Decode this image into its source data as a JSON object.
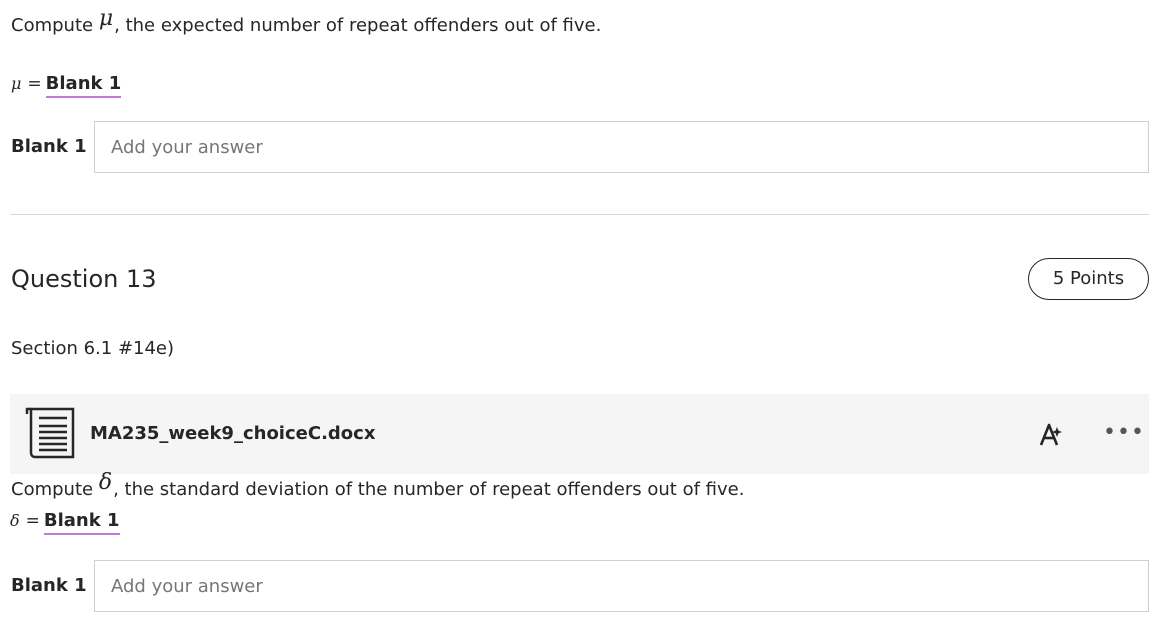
{
  "q12_tail": {
    "prompt_prefix": "Compute ",
    "prompt_symbol": "μ",
    "prompt_suffix": ", the expected number of repeat offenders out of five.",
    "formula_symbol": "μ",
    "formula_equals": "=",
    "formula_blank": "Blank 1",
    "blank_label": "Blank 1",
    "answer_placeholder": "Add your answer",
    "answer_value": ""
  },
  "question13": {
    "title": "Question 13",
    "points": "5 Points",
    "section_ref": "Section 6.1 #14e)",
    "attachment": {
      "file_name": "MA235_week9_choiceC.docx",
      "file_icon": "document-icon",
      "reader_icon": "immersive-reader-icon",
      "more_icon": "more-options-icon",
      "more_glyph": "•••"
    },
    "prompt_prefix": "Compute ",
    "prompt_symbol": "δ",
    "prompt_suffix": ", the standard deviation of the number of repeat offenders out of five.",
    "formula_symbol": "δ",
    "formula_equals": "=",
    "formula_blank": "Blank 1",
    "blank_label": "Blank 1",
    "answer_placeholder": "Add your answer",
    "answer_value": ""
  },
  "colors": {
    "blank_underline": "#c377d8",
    "attachment_bg": "#f5f5f5",
    "input_border": "#cfcfcf",
    "divider": "#d8d8d8"
  }
}
